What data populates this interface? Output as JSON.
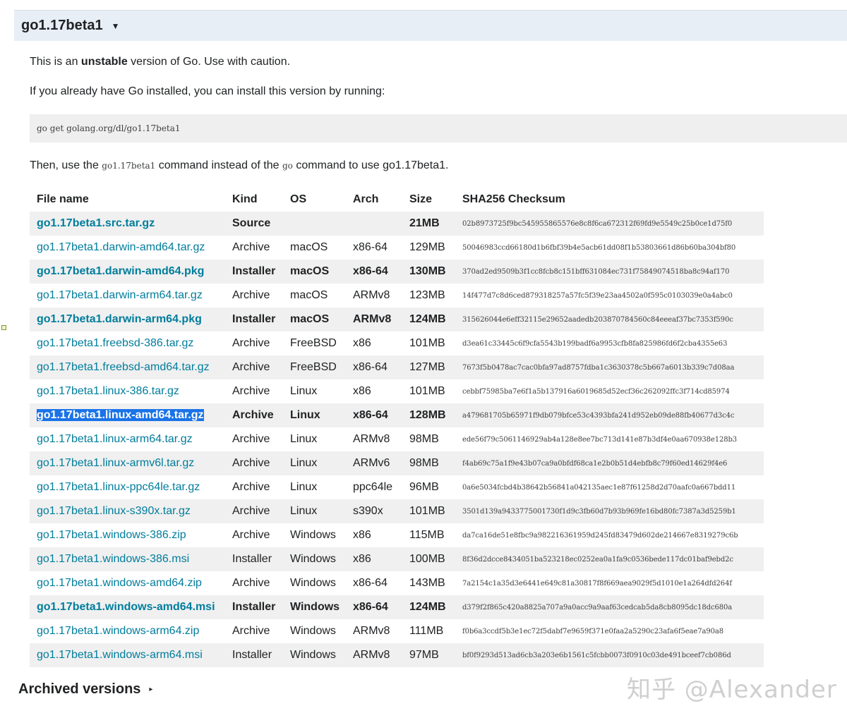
{
  "release": {
    "title": "go1.17beta1",
    "caret": "▼"
  },
  "intro": {
    "line1_pre": "This is an ",
    "line1_bold": "unstable",
    "line1_post": " version of Go. Use with caution.",
    "line2": "If you already have Go installed, you can install this version by running:",
    "install_command": "go get golang.org/dl/go1.17beta1",
    "line3_pre": "Then, use the ",
    "line3_code1": "go1.17beta1",
    "line3_mid": " command instead of the ",
    "line3_code2": "go",
    "line3_post": " command to use go1.17beta1."
  },
  "table": {
    "headers": [
      "File name",
      "Kind",
      "OS",
      "Arch",
      "Size",
      "SHA256 Checksum"
    ],
    "rows": [
      {
        "file": "go1.17beta1.src.tar.gz",
        "kind": "Source",
        "os": "",
        "arch": "",
        "size": "21MB",
        "sha": "02b8973725f9bc545955865576e8c8f6ca672312f69fd9e5549c25b0ce1d75f0",
        "highlight": true
      },
      {
        "file": "go1.17beta1.darwin-amd64.tar.gz",
        "kind": "Archive",
        "os": "macOS",
        "arch": "x86-64",
        "size": "129MB",
        "sha": "50046983ccd66180d1b6fbf39b4e5acb61dd08f1b53803661d86b60ba304bf80",
        "highlight": false
      },
      {
        "file": "go1.17beta1.darwin-amd64.pkg",
        "kind": "Installer",
        "os": "macOS",
        "arch": "x86-64",
        "size": "130MB",
        "sha": "370ad2ed9509b3f1cc8fcb8c151bff631084ec731f75849074518ba8c94af170",
        "highlight": true
      },
      {
        "file": "go1.17beta1.darwin-arm64.tar.gz",
        "kind": "Archive",
        "os": "macOS",
        "arch": "ARMv8",
        "size": "123MB",
        "sha": "14f477d7c8d6ced879318257a57fc5f39e23aa4502a0f595c0103039e0a4abc0",
        "highlight": false
      },
      {
        "file": "go1.17beta1.darwin-arm64.pkg",
        "kind": "Installer",
        "os": "macOS",
        "arch": "ARMv8",
        "size": "124MB",
        "sha": "315626044e6eff32115e29652aadedb203870784560c84eeeaf37bc7353f590c",
        "highlight": true
      },
      {
        "file": "go1.17beta1.freebsd-386.tar.gz",
        "kind": "Archive",
        "os": "FreeBSD",
        "arch": "x86",
        "size": "101MB",
        "sha": "d3ea61c33445c6f9cfa5543b199badf6a9953cfb8fa825986fd6f2cba4355e63",
        "highlight": false
      },
      {
        "file": "go1.17beta1.freebsd-amd64.tar.gz",
        "kind": "Archive",
        "os": "FreeBSD",
        "arch": "x86-64",
        "size": "127MB",
        "sha": "7673f5b0478ac7cac0bfa97ad8757fdba1c3630378c5b667a6013b339c7d08aa",
        "highlight": false
      },
      {
        "file": "go1.17beta1.linux-386.tar.gz",
        "kind": "Archive",
        "os": "Linux",
        "arch": "x86",
        "size": "101MB",
        "sha": "cebbf75985ba7e6f1a5b137916a6019685d52ecf36c262092ffc3f714cd85974",
        "highlight": false
      },
      {
        "file": "go1.17beta1.linux-amd64.tar.gz",
        "kind": "Archive",
        "os": "Linux",
        "arch": "x86-64",
        "size": "128MB",
        "sha": "a479681705b65971f9db079bfce53c4393bfa241d952eb09de88fb40677d3c4c",
        "highlight": true,
        "selected": true
      },
      {
        "file": "go1.17beta1.linux-arm64.tar.gz",
        "kind": "Archive",
        "os": "Linux",
        "arch": "ARMv8",
        "size": "98MB",
        "sha": "ede56f79c5061146929ab4a128e8ee7bc713d141e87b3df4e0aa670938e128b3",
        "highlight": false
      },
      {
        "file": "go1.17beta1.linux-armv6l.tar.gz",
        "kind": "Archive",
        "os": "Linux",
        "arch": "ARMv6",
        "size": "98MB",
        "sha": "f4ab69c75a1f9e43b07ca9a0bfdf68ca1e2b0b51d4ebfb8c79f60ed14629f4e6",
        "highlight": false
      },
      {
        "file": "go1.17beta1.linux-ppc64le.tar.gz",
        "kind": "Archive",
        "os": "Linux",
        "arch": "ppc64le",
        "size": "96MB",
        "sha": "0a6e5034fcbd4b38642b56841a042135aec1e87f61258d2d70aafc0a667bdd11",
        "highlight": false
      },
      {
        "file": "go1.17beta1.linux-s390x.tar.gz",
        "kind": "Archive",
        "os": "Linux",
        "arch": "s390x",
        "size": "101MB",
        "sha": "3501d139a9433775001730f1d9c3fb60d7b93b969fe16bd80fc7387a3d5259b1",
        "highlight": false
      },
      {
        "file": "go1.17beta1.windows-386.zip",
        "kind": "Archive",
        "os": "Windows",
        "arch": "x86",
        "size": "115MB",
        "sha": "da7ca16de51e8fbc9a982216361959d245fd83479d602de214667e8319279c6b",
        "highlight": false
      },
      {
        "file": "go1.17beta1.windows-386.msi",
        "kind": "Installer",
        "os": "Windows",
        "arch": "x86",
        "size": "100MB",
        "sha": "8f36d2dcce8434051ba523218ec0252ea0a1fa9c0536bede117dc01baf9ebd2c",
        "highlight": false
      },
      {
        "file": "go1.17beta1.windows-amd64.zip",
        "kind": "Archive",
        "os": "Windows",
        "arch": "x86-64",
        "size": "143MB",
        "sha": "7a2154c1a35d3e6441e649c81a30817f8f669aea9029f5d1010e1a264dfd264f",
        "highlight": false
      },
      {
        "file": "go1.17beta1.windows-amd64.msi",
        "kind": "Installer",
        "os": "Windows",
        "arch": "x86-64",
        "size": "124MB",
        "sha": "d379f2f865c420a8825a707a9a0acc9a9aaf63cedcab5da8cb8095dc18dc680a",
        "highlight": true
      },
      {
        "file": "go1.17beta1.windows-arm64.zip",
        "kind": "Archive",
        "os": "Windows",
        "arch": "ARMv8",
        "size": "111MB",
        "sha": "f0b6a3ccdf5b3e1ec72f5dabf7e9659f371e0faa2a5290c23afa6f5eae7a90a8",
        "highlight": false
      },
      {
        "file": "go1.17beta1.windows-arm64.msi",
        "kind": "Installer",
        "os": "Windows",
        "arch": "ARMv8",
        "size": "97MB",
        "sha": "bf0f9293d513ad6cb3a203e6b1561c5fcbb0073f0910c03de491bceef7cb086d",
        "highlight": false
      }
    ]
  },
  "archived": {
    "label": "Archived versions",
    "caret": "▸"
  },
  "watermark": "知乎 @Alexander",
  "colors": {
    "link": "#007d9c",
    "header_bg": "#e8eef6",
    "selection": "#1a73e8"
  }
}
